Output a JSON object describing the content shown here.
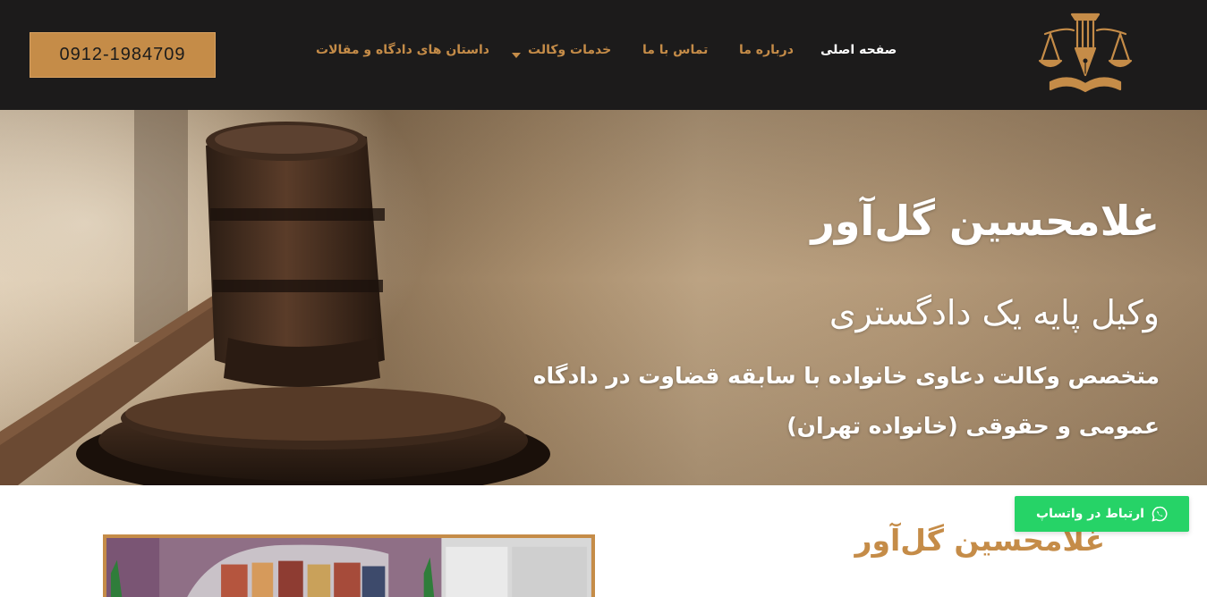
{
  "header": {
    "phone": "0912-1984709",
    "nav": {
      "home": "صفحه اصلی",
      "about": "درباره ما",
      "contact": "تماس با ما",
      "services": "خدمات وکالت",
      "stories": "داستان های دادگاه و مقالات"
    }
  },
  "hero": {
    "name": "غلامحسین گل‌آور",
    "title": "وکیل پایه یک دادگستری",
    "description": "متخصص وکالت دعاوی خانواده با سابقه قضاوت در دادگاه عمومی و حقوقی (خانواده تهران)"
  },
  "about": {
    "name": "غلامحسین گل‌آور"
  },
  "whatsapp": {
    "label": "ارتباط در واتساپ"
  },
  "colors": {
    "accent": "#c58c48",
    "header_bg": "#1c1b1b",
    "whatsapp": "#26d367"
  }
}
